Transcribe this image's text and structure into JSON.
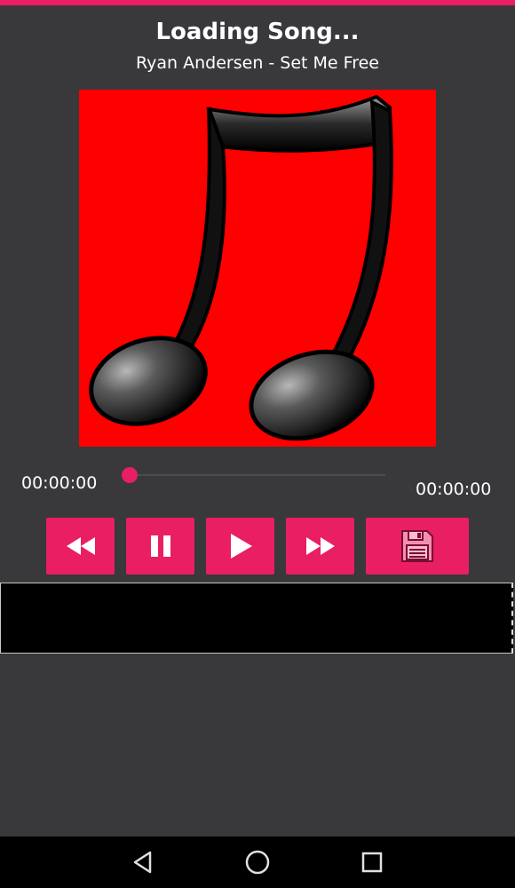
{
  "player": {
    "title": "Loading Song...",
    "subtitle": "Ryan Andersen - Set Me Free",
    "album_art": {
      "icon": "music-note-icon",
      "background_color": "#ff0000"
    },
    "time_current": "00:00:00",
    "time_total": "00:00:00",
    "progress": 0
  },
  "controls": [
    {
      "name": "rewind-button",
      "icon": "rewind-icon"
    },
    {
      "name": "pause-button",
      "icon": "pause-icon"
    },
    {
      "name": "play-button",
      "icon": "play-icon"
    },
    {
      "name": "fast-forward-button",
      "icon": "fast-forward-icon"
    },
    {
      "name": "save-button",
      "icon": "floppy-disk-icon"
    }
  ],
  "nav_bar": {
    "items": [
      {
        "name": "back",
        "icon": "back-triangle-icon"
      },
      {
        "name": "home",
        "icon": "home-circle-icon"
      },
      {
        "name": "recents",
        "icon": "recents-square-icon"
      }
    ]
  },
  "colors": {
    "accent": "#e91e63",
    "background": "#39383b",
    "nav_bar": "#000000"
  }
}
